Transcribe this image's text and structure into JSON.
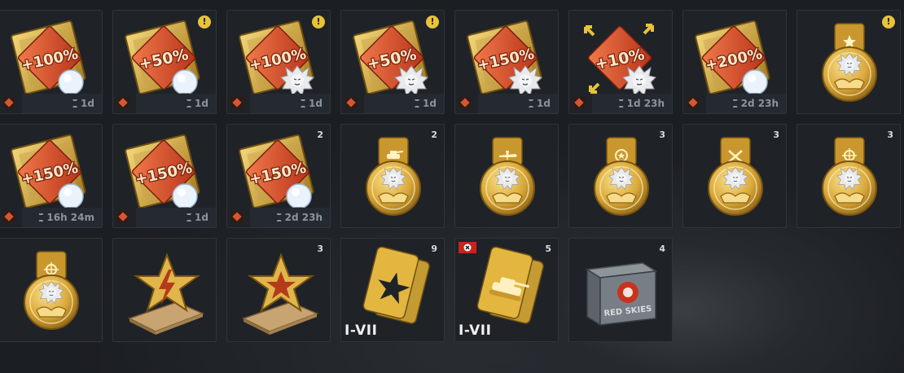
{
  "rows": [
    [
      {
        "type": "booster",
        "bonus": "+100%",
        "emblem": "bulb-icon",
        "timer": "1d",
        "alert": false,
        "count": ""
      },
      {
        "type": "booster",
        "bonus": "+50%",
        "emblem": "bulb-icon",
        "timer": "1d",
        "alert": true,
        "count": ""
      },
      {
        "type": "booster",
        "bonus": "+100%",
        "emblem": "lion-icon",
        "timer": "1d",
        "alert": true,
        "count": ""
      },
      {
        "type": "booster",
        "bonus": "+50%",
        "emblem": "lion-icon",
        "timer": "1d",
        "alert": true,
        "count": ""
      },
      {
        "type": "booster",
        "bonus": "+150%",
        "emblem": "lion-icon",
        "timer": "1d",
        "alert": false,
        "count": ""
      },
      {
        "type": "booster",
        "bonus": "+10%",
        "emblem": "lion-icon",
        "timer": "1d 23h",
        "alert": false,
        "count": "",
        "arrows": true
      },
      {
        "type": "booster",
        "bonus": "+200%",
        "emblem": "bulb-icon",
        "timer": "2d 23h",
        "alert": false,
        "count": ""
      },
      {
        "type": "medal",
        "symbol": "star",
        "alert": true,
        "count": ""
      }
    ],
    [
      {
        "type": "booster",
        "bonus": "+150%",
        "emblem": "bulb-icon",
        "timer": "16h 24m",
        "alert": false,
        "count": ""
      },
      {
        "type": "booster",
        "bonus": "+150%",
        "emblem": "bulb-icon",
        "timer": "1d",
        "alert": false,
        "count": ""
      },
      {
        "type": "booster",
        "bonus": "+150%",
        "emblem": "bulb-icon",
        "timer": "2d 23h",
        "alert": false,
        "count": "2"
      },
      {
        "type": "medal",
        "symbol": "tank",
        "alert": false,
        "count": "2"
      },
      {
        "type": "medal",
        "symbol": "plane",
        "alert": false,
        "count": ""
      },
      {
        "type": "medal",
        "symbol": "wreath",
        "alert": false,
        "count": "3"
      },
      {
        "type": "medal",
        "symbol": "swords",
        "alert": false,
        "count": "3"
      },
      {
        "type": "medal",
        "symbol": "crosshair",
        "alert": false,
        "count": "3"
      }
    ],
    [
      {
        "type": "medal",
        "symbol": "crosshair",
        "alert": false,
        "count": ""
      },
      {
        "type": "star-trophy",
        "variant": "lightning",
        "count": ""
      },
      {
        "type": "star-trophy",
        "variant": "star",
        "count": "3"
      },
      {
        "type": "card",
        "symbol": "star",
        "tier": "I-VII",
        "count": "9"
      },
      {
        "type": "card",
        "symbol": "tank",
        "tier": "I-VII",
        "count": "5",
        "flag": true
      },
      {
        "type": "crate",
        "crate_label": "RED SKIES",
        "count": "4"
      }
    ]
  ],
  "alert_mark": "!",
  "colors": {
    "gold": "#e3b640",
    "red": "#d6482a",
    "tile_bg": "#1f2328"
  }
}
